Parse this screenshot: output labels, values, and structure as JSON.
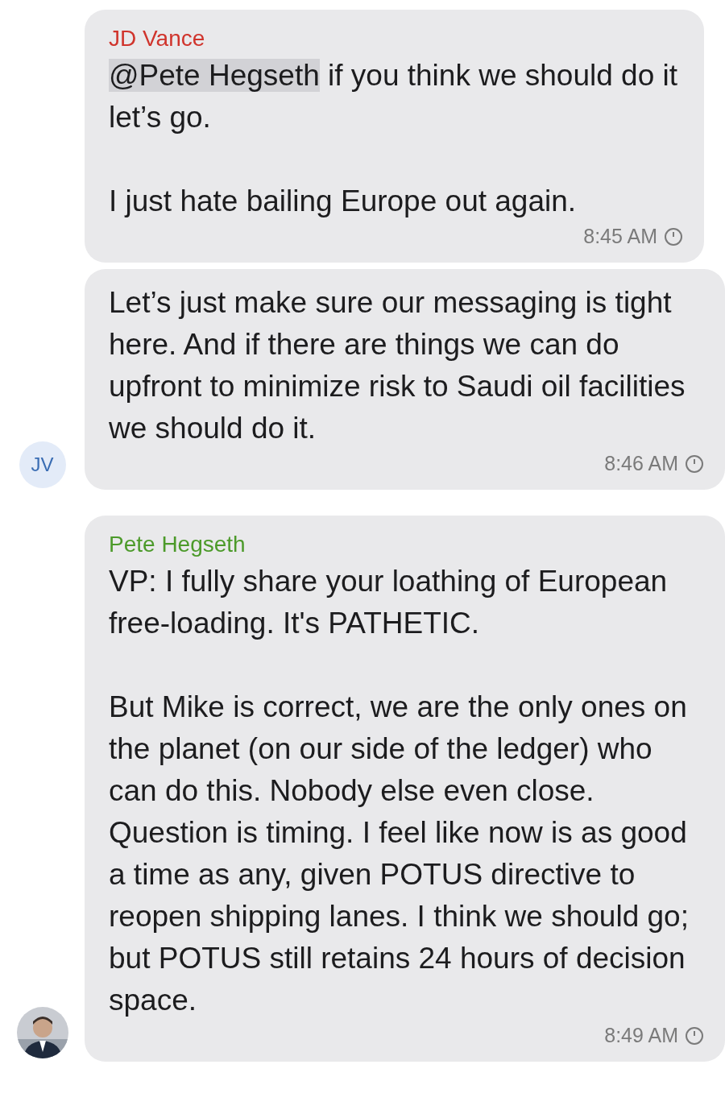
{
  "groups": [
    {
      "sender": "JD Vance",
      "color": "#d0342c",
      "avatar": {
        "kind": "initials",
        "initials": "JV"
      },
      "bubbles": [
        {
          "mention": "@Pete Hegseth",
          "paragraphs": [
            " if you think we should do it let’s go.",
            "I just hate bailing Europe out again."
          ],
          "time": "8:45 AM"
        },
        {
          "paragraphs": [
            "Let’s just make sure our messaging is tight here. And if there are things we can do upfront to minimize risk to Saudi oil facilities we should do it."
          ],
          "time": "8:46 AM"
        }
      ]
    },
    {
      "sender": "Pete Hegseth",
      "color": "#4c9a2a",
      "avatar": {
        "kind": "picture"
      },
      "bubbles": [
        {
          "paragraphs": [
            "VP: I fully share your loathing of European free-loading. It's PATHETIC.",
            "But Mike is correct, we are the only ones on the planet (on our side of the ledger) who can do this. Nobody else even close. Question is timing. I feel like now is as good a time as any, given POTUS directive to reopen shipping lanes. I think we should go; but POTUS still retains 24 hours of decision space."
          ],
          "time": "8:49 AM"
        }
      ]
    }
  ]
}
